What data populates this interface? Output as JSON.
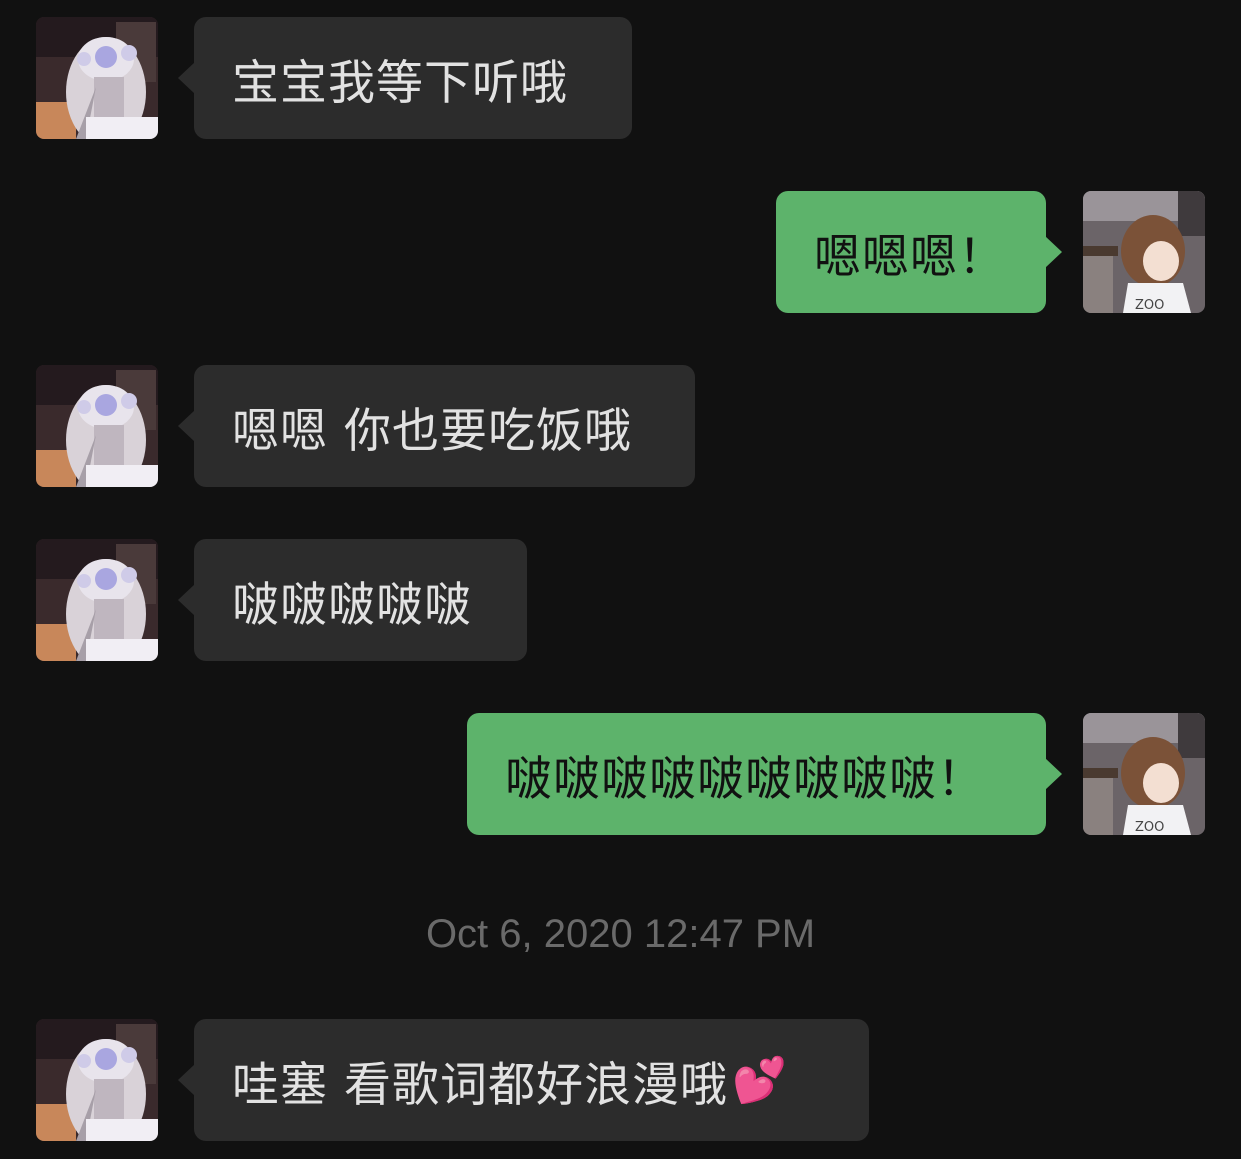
{
  "messages": [
    {
      "side": "left",
      "text": "宝宝我等下听哦"
    },
    {
      "side": "right",
      "text": "嗯嗯嗯！"
    },
    {
      "side": "left",
      "text": "嗯嗯 你也要吃饭哦"
    },
    {
      "side": "left",
      "text": "啵啵啵啵啵"
    },
    {
      "side": "right",
      "text": "啵啵啵啵啵啵啵啵啵！"
    },
    {
      "side": "left",
      "text": "哇塞 看歌词都好浪漫哦",
      "emoji": "💕"
    }
  ],
  "timestamp": "Oct 6, 2020 12:47 PM",
  "colors": {
    "background": "#111111",
    "incoming_bubble": "#2c2c2c",
    "outgoing_bubble": "#5db36b",
    "timestamp_text": "#6a6a6a"
  },
  "avatars": {
    "contact": "anime-girl-avatar",
    "self": "anime-boy-avatar"
  }
}
